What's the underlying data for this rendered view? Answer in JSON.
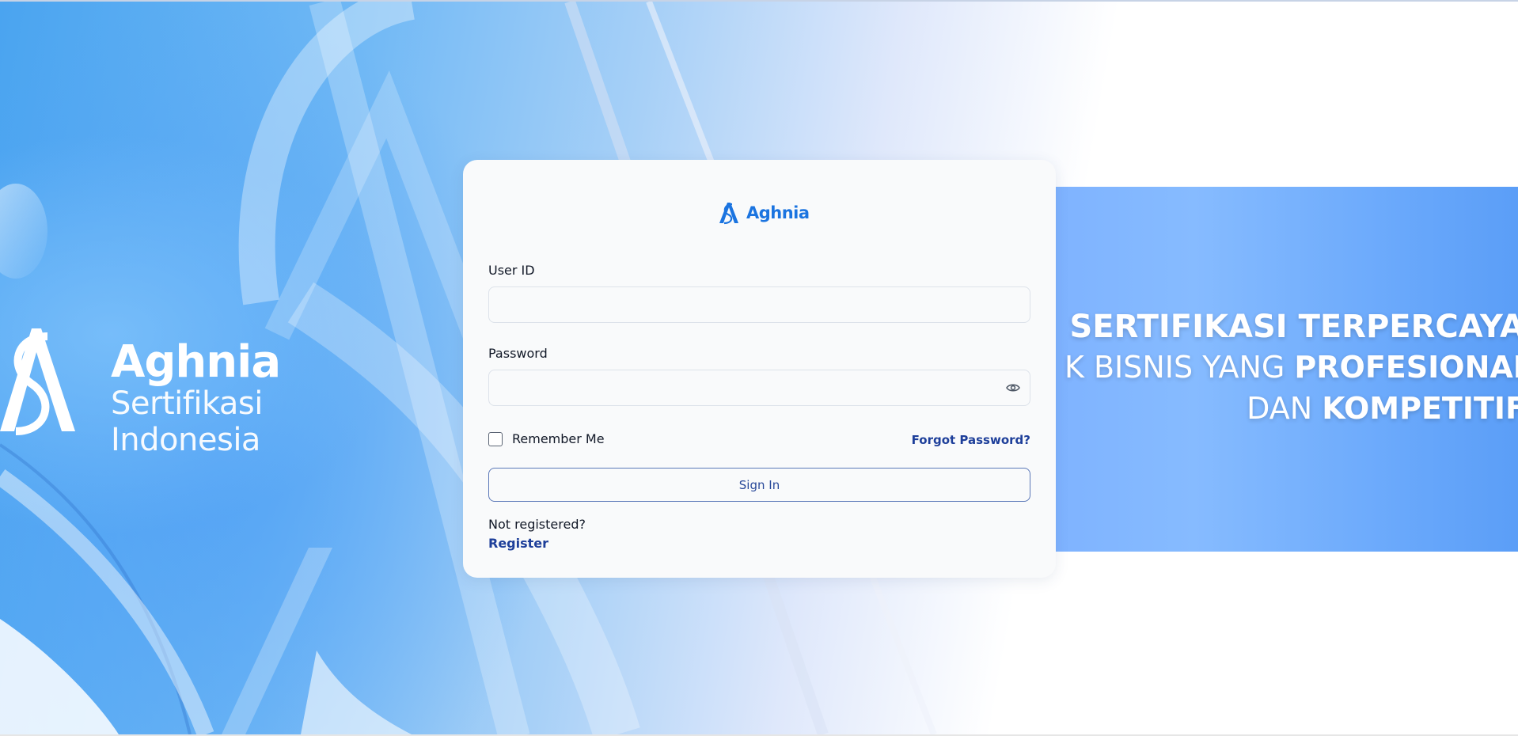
{
  "brand": {
    "name": "Aghnia",
    "tagline": "Sertifikasi Indonesia"
  },
  "banner": {
    "line1": "SERTIFIKASI TERPERCAYA",
    "line2_regular": "K BISNIS YANG ",
    "line2_bold": "PROFESIONAL",
    "line3_regular": "DAN ",
    "line3_bold": "KOMPETITIF"
  },
  "login": {
    "logo_text": "Aghnia",
    "user_id_label": "User ID",
    "user_id_value": "",
    "password_label": "Password",
    "password_value": "",
    "remember_label": "Remember Me",
    "remember_checked": false,
    "forgot_label": "Forgot Password?",
    "signin_label": "Sign In",
    "not_registered_text": "Not registered?",
    "register_label": "Register"
  },
  "icons": {
    "show_password": "eye-icon",
    "logo": "aghnia-logo-icon"
  },
  "colors": {
    "accent": "#1b74e0",
    "link": "#1e3f9a",
    "button_border": "#5b78b8",
    "banner_blue": "#6fb0fc"
  }
}
